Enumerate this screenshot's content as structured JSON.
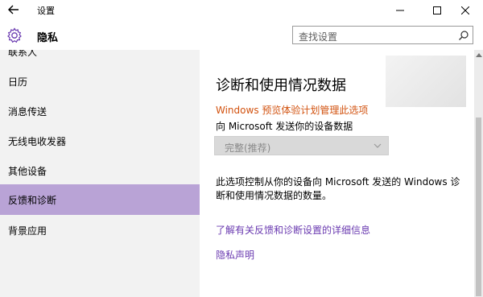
{
  "window": {
    "title": "设置"
  },
  "header": {
    "title": "隐私",
    "search_placeholder": "查找设置"
  },
  "sidebar": {
    "cut_item": "联系人",
    "items": [
      {
        "label": "日历"
      },
      {
        "label": "消息传送"
      },
      {
        "label": "无线电收发器"
      },
      {
        "label": "其他设备"
      },
      {
        "label": "反馈和诊断",
        "active": true
      },
      {
        "label": "背景应用"
      }
    ]
  },
  "content": {
    "heading": "诊断和使用情况数据",
    "warning": "Windows 预览体验计划管理此选项",
    "send_label": "向 Microsoft 发送你的设备数据",
    "dropdown_value": "完整(推荐)",
    "description": "此选项控制从你的设备向 Microsoft 发送的 Windows 诊断和使用情况数据的数量。",
    "link_learn_more": "了解有关反馈和诊断设置的详细信息",
    "link_privacy": "隐私声明"
  },
  "colors": {
    "accent": "#b9a3d6",
    "warning": "#d2520f",
    "link": "#6a3ab0"
  },
  "icons": [
    "back-arrow-icon",
    "minimize-icon",
    "maximize-icon",
    "close-icon",
    "gear-icon",
    "search-icon",
    "chevron-down-icon"
  ]
}
